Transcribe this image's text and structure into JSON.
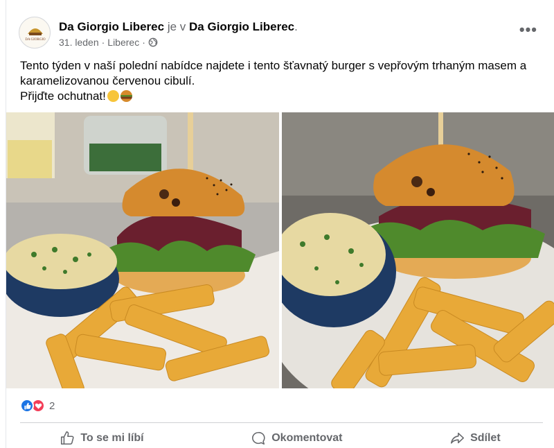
{
  "post": {
    "page_name": "Da Giorgio Liberec",
    "connector": "je v",
    "location_name": "Da Giorgio Liberec",
    "trailing_dot": ".",
    "date": "31. leden",
    "sep1": "·",
    "place": "Liberec",
    "sep2": "·",
    "privacy_icon": "globe-icon",
    "more_label": "•••",
    "avatar_logo_text": "DA GIORGIO",
    "text_line1": "Tento týden v naší polední nabídce najdete i tento šťavnatý burger s vepřovým trhaným masem a karamelizovanou červenou cibulí.",
    "text_line2": "Přijďte ochutnat!",
    "emojis": [
      "smiling-face-emoji",
      "hamburger-emoji"
    ]
  },
  "reactions": {
    "types": [
      "like",
      "love"
    ],
    "count": "2"
  },
  "actions": {
    "like": "To se mi líbí",
    "comment": "Okomentovat",
    "share": "Sdílet"
  },
  "colors": {
    "like_blue": "#1b74e4",
    "love_red": "#f33e58",
    "muted_text": "#65676b"
  }
}
